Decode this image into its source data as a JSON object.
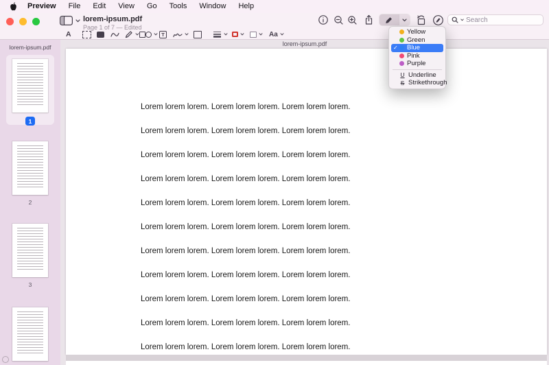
{
  "menubar": {
    "items": [
      "Preview",
      "File",
      "Edit",
      "View",
      "Go",
      "Tools",
      "Window",
      "Help"
    ]
  },
  "window": {
    "title": "lorem-ipsum.pdf",
    "page_status": "Page 1 of 7 — Edited"
  },
  "toolbar": {
    "search_placeholder": "Search"
  },
  "markup_icons": {
    "text_selection": "A",
    "text_tool": "T",
    "text_style": "Aa"
  },
  "sidebar": {
    "filename": "lorem-ipsum.pdf",
    "thumbnails": [
      {
        "label": "1",
        "selected": true
      },
      {
        "label": "2"
      },
      {
        "label": "3"
      },
      {
        "label": ""
      }
    ]
  },
  "content": {
    "header": "lorem-ipsum.pdf",
    "lines": [
      "Lorem lorem lorem. Lorem lorem lorem. Lorem lorem lorem.",
      "Lorem lorem lorem. Lorem lorem lorem. Lorem lorem lorem.",
      "Lorem lorem lorem. Lorem lorem lorem. Lorem lorem lorem.",
      "Lorem lorem lorem. Lorem lorem lorem. Lorem lorem lorem.",
      "Lorem lorem lorem. Lorem lorem lorem. Lorem lorem lorem.",
      "Lorem lorem lorem. Lorem lorem lorem. Lorem lorem lorem.",
      "Lorem lorem lorem. Lorem lorem lorem. Lorem lorem lorem.",
      "Lorem lorem lorem. Lorem lorem lorem. Lorem lorem lorem.",
      "Lorem lorem lorem. Lorem lorem lorem. Lorem lorem lorem.",
      "Lorem lorem lorem. Lorem lorem lorem. Lorem lorem lorem.",
      "Lorem lorem lorem. Lorem lorem lorem. Lorem lorem lorem."
    ]
  },
  "menu": {
    "check": "✓",
    "items": [
      {
        "label": "Yellow",
        "color": "#f2b01d"
      },
      {
        "label": "Green",
        "color": "#63c544"
      },
      {
        "label": "Blue",
        "color": "#2d7ff5",
        "selected": true
      },
      {
        "label": "Pink",
        "color": "#f04a77"
      },
      {
        "label": "Purple",
        "color": "#bc5ec6"
      }
    ],
    "actions": [
      {
        "label": "Underline",
        "glyph": "U"
      },
      {
        "label": "Strikethrough",
        "glyph": "S"
      }
    ]
  },
  "colors": {
    "traffic_red": "#ff5f57",
    "traffic_yellow": "#febc2e",
    "traffic_green": "#28c840",
    "badge_blue": "#1d6bf3",
    "menu_highlight": "#3a7cf7",
    "border_swatch": "#d0342c"
  }
}
